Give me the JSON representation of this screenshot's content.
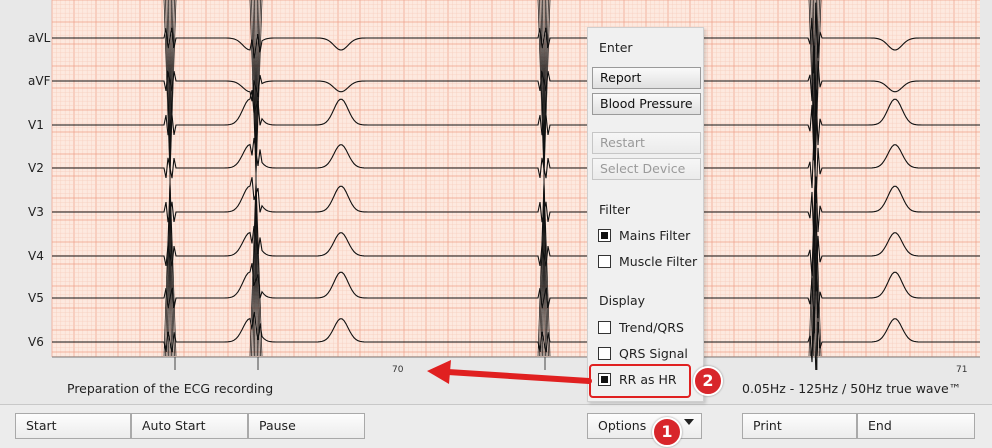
{
  "leads": [
    "aVL",
    "aVF",
    "V1",
    "V2",
    "V3",
    "V4",
    "V5",
    "V6"
  ],
  "status_text": "Preparation of the ECG recording",
  "filter_info": "0.05Hz - 125Hz / 50Hz true wave™",
  "tick_labels": [
    "70",
    "71"
  ],
  "toolbar": {
    "start": "Start",
    "auto_start": "Auto Start",
    "pause": "Pause",
    "options": "Options",
    "print": "Print",
    "end": "End"
  },
  "menu": {
    "enter": "Enter",
    "report": "Report",
    "blood_pressure": "Blood Pressure",
    "restart": "Restart",
    "select_device": "Select Device",
    "filter_heading": "Filter",
    "mains_filter": "Mains Filter",
    "muscle_filter": "Muscle Filter",
    "display_heading": "Display",
    "trend_qrs": "Trend/QRS",
    "qrs_signal": "QRS Signal",
    "rr_as_hr": "RR as HR"
  },
  "checkbox_states": {
    "mains_filter": true,
    "muscle_filter": false,
    "trend_qrs": false,
    "qrs_signal": false,
    "rr_as_hr": true
  },
  "annotations": [
    "1",
    "2"
  ],
  "colors": {
    "grid_background": "#fde9df",
    "grid_minor": "#f6cdbd",
    "grid_major": "#ee9f88",
    "trace": "#111111",
    "callout": "#d8262b"
  }
}
